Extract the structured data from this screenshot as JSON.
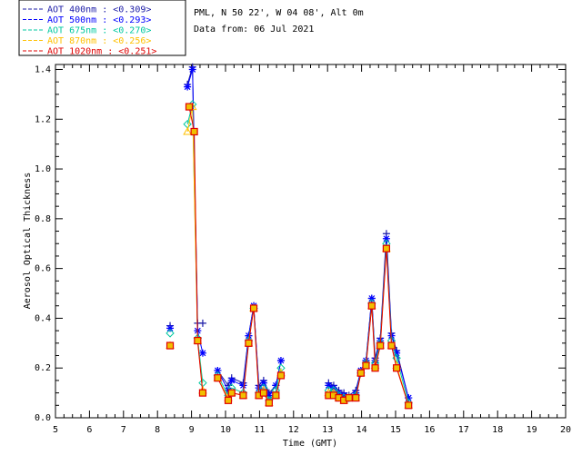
{
  "chart_data": {
    "type": "line",
    "site_line": "PML, N 50 22', W 04 08', Alt 0m",
    "date_line": "Data from: 06 Jul 2021",
    "xlabel": "Time (GMT)",
    "ylabel": "Aerosol Optical Thickness",
    "xlim": [
      5,
      20
    ],
    "ylim": [
      0,
      1.42
    ],
    "x_ticks": [
      "5",
      "6",
      "7",
      "8",
      "9",
      "10",
      "11",
      "12",
      "13",
      "14",
      "15",
      "16",
      "17",
      "18",
      "19",
      "20"
    ],
    "y_ticks": [
      "0.0",
      "0.2",
      "0.4",
      "0.6",
      "0.8",
      "1.0",
      "1.2",
      "1.4"
    ],
    "legend_position": "top-left, outside plot",
    "grid": false,
    "series": [
      {
        "legend": "AOT  400nm : <0.309>",
        "color": "#1a1aa6",
        "marker": "plus",
        "points": [
          [
            8.37,
            0.37
          ],
          [
            8.88,
            1.34
          ],
          [
            9.03,
            1.41
          ],
          [
            9.18,
            0.38
          ],
          [
            9.33,
            0.38
          ],
          [
            9.77,
            0.19
          ],
          [
            10.08,
            0.13
          ],
          [
            10.18,
            0.16
          ],
          [
            10.52,
            0.14
          ],
          [
            10.68,
            0.33
          ],
          [
            10.83,
            0.45
          ],
          [
            10.98,
            0.13
          ],
          [
            11.12,
            0.15
          ],
          [
            11.28,
            0.1
          ],
          [
            11.48,
            0.13
          ],
          [
            11.63,
            0.23
          ],
          [
            13.03,
            0.14
          ],
          [
            13.18,
            0.13
          ],
          [
            13.33,
            0.11
          ],
          [
            13.48,
            0.1
          ],
          [
            13.63,
            0.09
          ],
          [
            13.83,
            0.11
          ],
          [
            13.98,
            0.19
          ],
          [
            14.13,
            0.23
          ],
          [
            14.3,
            0.48
          ],
          [
            14.4,
            0.24
          ],
          [
            14.55,
            0.32
          ],
          [
            14.73,
            0.74
          ],
          [
            14.88,
            0.34
          ],
          [
            15.03,
            0.27
          ],
          [
            15.38,
            0.08
          ]
        ]
      },
      {
        "legend": "AOT  500nm : <0.293>",
        "color": "#0000ff",
        "marker": "star",
        "points": [
          [
            8.37,
            0.36
          ],
          [
            8.88,
            1.33
          ],
          [
            9.03,
            1.4
          ],
          [
            9.18,
            0.35
          ],
          [
            9.33,
            0.26
          ],
          [
            9.77,
            0.19
          ],
          [
            10.08,
            0.11
          ],
          [
            10.18,
            0.15
          ],
          [
            10.52,
            0.13
          ],
          [
            10.68,
            0.33
          ],
          [
            10.83,
            0.45
          ],
          [
            10.98,
            0.12
          ],
          [
            11.12,
            0.14
          ],
          [
            11.28,
            0.09
          ],
          [
            11.48,
            0.13
          ],
          [
            11.63,
            0.23
          ],
          [
            13.03,
            0.13
          ],
          [
            13.18,
            0.12
          ],
          [
            13.33,
            0.1
          ],
          [
            13.48,
            0.09
          ],
          [
            13.63,
            0.08
          ],
          [
            13.83,
            0.1
          ],
          [
            13.98,
            0.19
          ],
          [
            14.13,
            0.23
          ],
          [
            14.3,
            0.48
          ],
          [
            14.4,
            0.23
          ],
          [
            14.55,
            0.31
          ],
          [
            14.73,
            0.72
          ],
          [
            14.88,
            0.33
          ],
          [
            15.03,
            0.26
          ],
          [
            15.38,
            0.08
          ]
        ]
      },
      {
        "legend": "AOT  675nm : <0.270>",
        "color": "#00c8a0",
        "marker": "diamond",
        "points": [
          [
            8.37,
            0.34
          ],
          [
            8.88,
            1.18
          ],
          [
            9.03,
            1.26
          ],
          [
            9.18,
            0.32
          ],
          [
            9.33,
            0.14
          ],
          [
            9.77,
            0.17
          ],
          [
            10.08,
            0.09
          ],
          [
            10.18,
            0.12
          ],
          [
            10.52,
            0.1
          ],
          [
            10.68,
            0.31
          ],
          [
            10.83,
            0.44
          ],
          [
            10.98,
            0.1
          ],
          [
            11.12,
            0.12
          ],
          [
            11.28,
            0.07
          ],
          [
            11.48,
            0.11
          ],
          [
            11.63,
            0.2
          ],
          [
            13.03,
            0.11
          ],
          [
            13.18,
            0.11
          ],
          [
            13.33,
            0.09
          ],
          [
            13.48,
            0.08
          ],
          [
            13.63,
            0.08
          ],
          [
            13.83,
            0.09
          ],
          [
            13.98,
            0.18
          ],
          [
            14.13,
            0.22
          ],
          [
            14.3,
            0.46
          ],
          [
            14.4,
            0.22
          ],
          [
            14.55,
            0.3
          ],
          [
            14.73,
            0.7
          ],
          [
            14.88,
            0.31
          ],
          [
            15.03,
            0.24
          ],
          [
            15.38,
            0.06
          ]
        ]
      },
      {
        "legend": "AOT  870nm : <0.256>",
        "color": "#ffc000",
        "marker": "triangle",
        "points": [
          [
            8.37,
            0.29
          ],
          [
            8.88,
            1.15
          ],
          [
            9.03,
            1.25
          ],
          [
            9.18,
            0.31
          ],
          [
            9.33,
            0.11
          ],
          [
            9.77,
            0.16
          ],
          [
            10.08,
            0.08
          ],
          [
            10.18,
            0.1
          ],
          [
            10.52,
            0.09
          ],
          [
            10.68,
            0.3
          ],
          [
            10.83,
            0.44
          ],
          [
            10.98,
            0.09
          ],
          [
            11.12,
            0.11
          ],
          [
            11.28,
            0.06
          ],
          [
            11.48,
            0.09
          ],
          [
            11.63,
            0.18
          ],
          [
            13.03,
            0.1
          ],
          [
            13.18,
            0.1
          ],
          [
            13.33,
            0.08
          ],
          [
            13.48,
            0.07
          ],
          [
            13.63,
            0.08
          ],
          [
            13.83,
            0.08
          ],
          [
            13.98,
            0.18
          ],
          [
            14.13,
            0.21
          ],
          [
            14.3,
            0.45
          ],
          [
            14.4,
            0.21
          ],
          [
            14.55,
            0.29
          ],
          [
            14.73,
            0.68
          ],
          [
            14.88,
            0.29
          ],
          [
            15.03,
            0.21
          ],
          [
            15.38,
            0.05
          ]
        ]
      },
      {
        "legend": "AOT 1020nm : <0.251>",
        "color": "#e00000",
        "marker": "square",
        "points": [
          [
            8.37,
            0.29
          ],
          [
            8.93,
            1.25
          ],
          [
            9.08,
            1.15
          ],
          [
            9.18,
            0.31
          ],
          [
            9.33,
            0.1
          ],
          [
            9.77,
            0.16
          ],
          [
            10.08,
            0.07
          ],
          [
            10.18,
            0.1
          ],
          [
            10.52,
            0.09
          ],
          [
            10.68,
            0.3
          ],
          [
            10.83,
            0.44
          ],
          [
            10.98,
            0.09
          ],
          [
            11.12,
            0.1
          ],
          [
            11.28,
            0.06
          ],
          [
            11.48,
            0.09
          ],
          [
            11.63,
            0.17
          ],
          [
            13.03,
            0.09
          ],
          [
            13.18,
            0.09
          ],
          [
            13.33,
            0.08
          ],
          [
            13.48,
            0.07
          ],
          [
            13.63,
            0.08
          ],
          [
            13.83,
            0.08
          ],
          [
            13.98,
            0.18
          ],
          [
            14.13,
            0.21
          ],
          [
            14.3,
            0.45
          ],
          [
            14.4,
            0.2
          ],
          [
            14.55,
            0.29
          ],
          [
            14.73,
            0.68
          ],
          [
            14.88,
            0.29
          ],
          [
            15.03,
            0.2
          ],
          [
            15.38,
            0.05
          ]
        ]
      }
    ]
  }
}
